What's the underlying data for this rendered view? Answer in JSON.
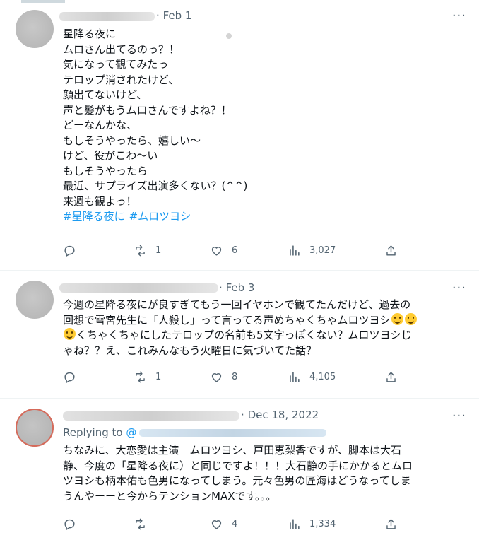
{
  "tweets": [
    {
      "date": "Feb 1",
      "lines": [
        "星降る夜に",
        "ムロさん出てるのっ？！",
        "気になって観てみたっ",
        "テロップ消されたけど、",
        "顔出てないけど、",
        "声と髪がもうムロさんですよね？！",
        "どーなんかな、",
        "もしそうやったら、嬉しい〜",
        "けど、役がこわ〜い",
        "もしそうやったら",
        "最近、サプライズ出演多くない？(^^)",
        "来週も観よっ！"
      ],
      "hashtags": [
        "#星降る夜に",
        "#ムロツヨシ"
      ],
      "retweets": "1",
      "likes": "6",
      "views": "3,027"
    },
    {
      "date": "Feb 3",
      "line1": "今週の星降る夜にが良すぎてもう一回イヤホンで観てたんだけど、過去の",
      "line2": "回想で雪宮先生に「人殺し」って言ってる声めちゃくちゃムロツヨシ",
      "line3": "くちゃくちゃにしたテロップの名前も5文字っぽくない？ムロツヨシじ",
      "line4": "ゃね？？え、これみんなもう火曜日に気づいてた話？",
      "retweets": "1",
      "likes": "8",
      "views": "4,105"
    },
    {
      "date": "Dec 18, 2022",
      "replying_label": "Replying to",
      "replying_at": "@",
      "lines": [
        "ちなみに、大恋愛は主演　ムロツヨシ、戸田恵梨香ですが、脚本は大石",
        "静、今度の「星降る夜に）と同じですよ！！！大石静の手にかかるとムロ",
        "ツヨシも柄本佑も色男になってしまう。元々色男の匠海はどうなってしま",
        "うんやーーと今からテンションMAXです。。。"
      ],
      "retweets": "",
      "likes": "4",
      "views": "1,334"
    }
  ],
  "more_glyph": "···",
  "date_sep": "·",
  "icons": [
    "reply-icon",
    "retweet-icon",
    "like-icon",
    "views-icon",
    "share-icon"
  ],
  "colors": {
    "link": "#1d9bf0",
    "muted": "#536471",
    "text": "#0f1419"
  }
}
